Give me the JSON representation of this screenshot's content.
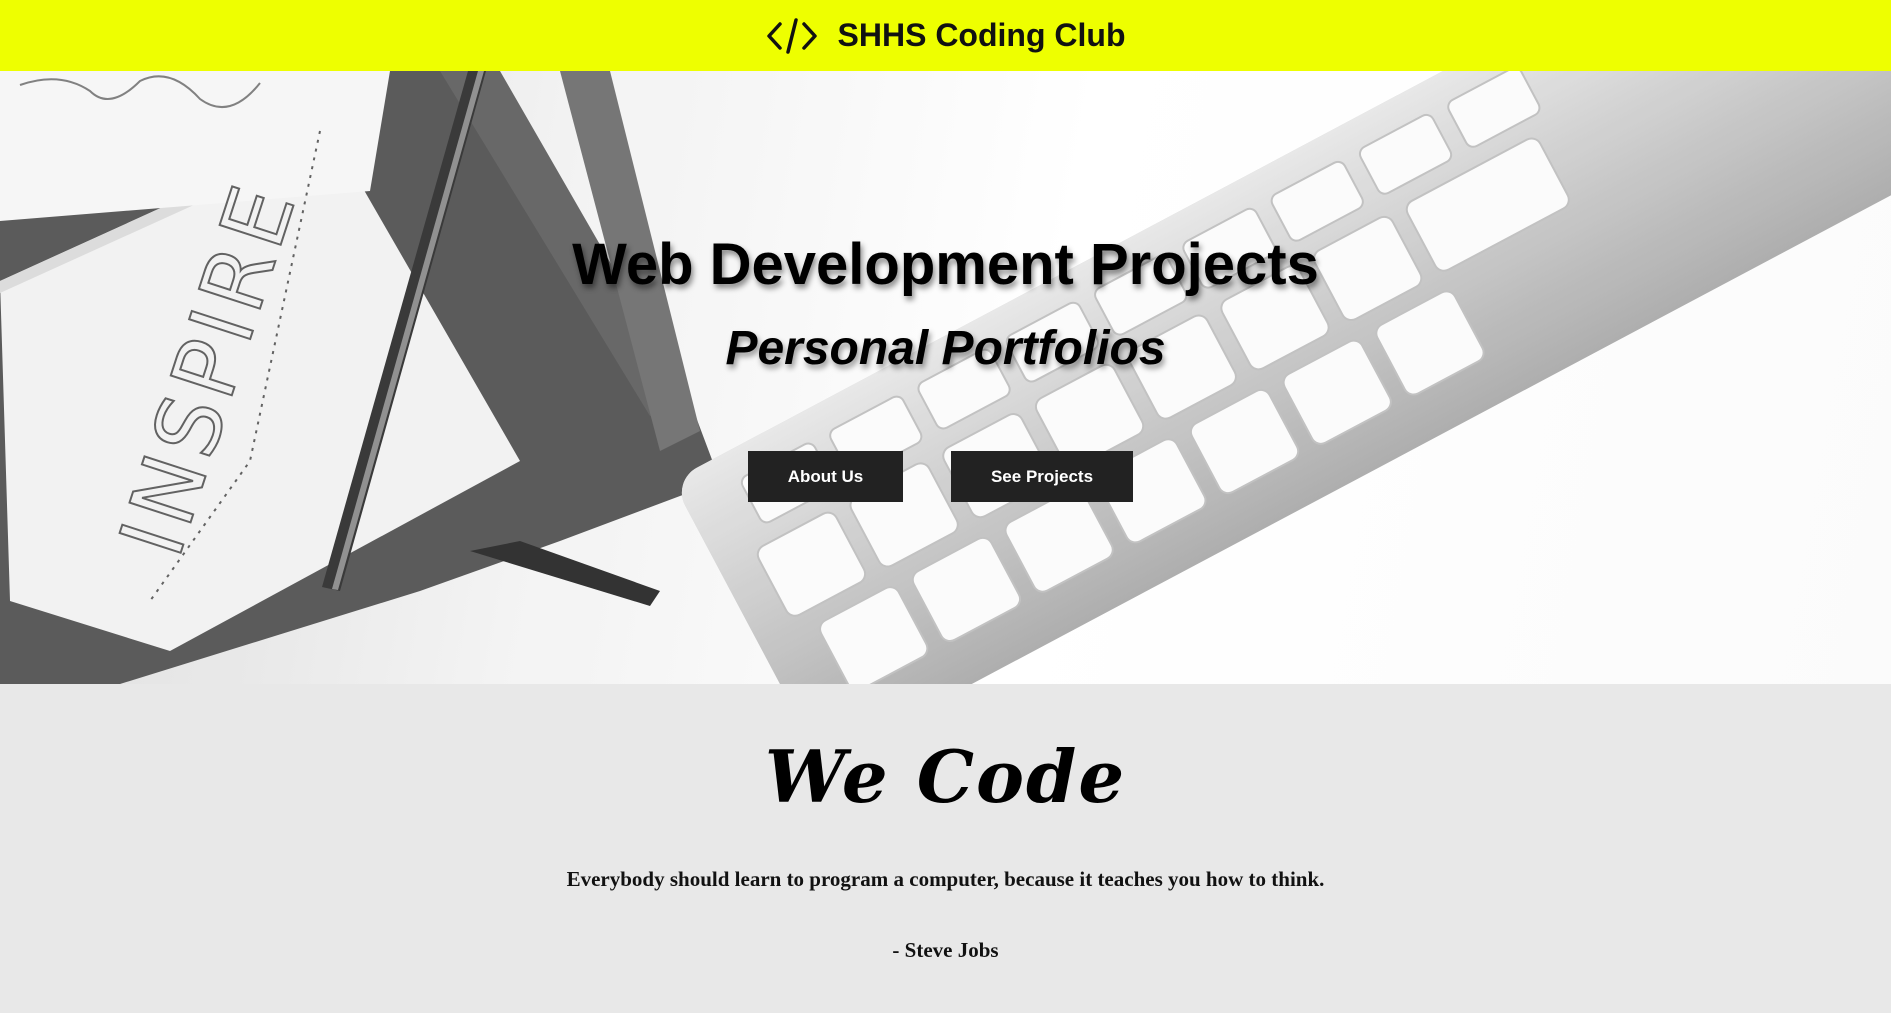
{
  "header": {
    "icon": "code-icon",
    "title": "SHHS Coding Club",
    "background": "#eeff00"
  },
  "hero": {
    "title": "Web Development Projects",
    "subtitle": "Personal Portfolios",
    "buttons": {
      "about": "About Us",
      "projects": "See Projects"
    },
    "notebook_text": "INSPIRE",
    "button_color": "#222222"
  },
  "quote": {
    "heading": "We Code",
    "text": "Everybody should learn to program a computer, because it teaches you how to think.",
    "author": "- Steve Jobs"
  }
}
